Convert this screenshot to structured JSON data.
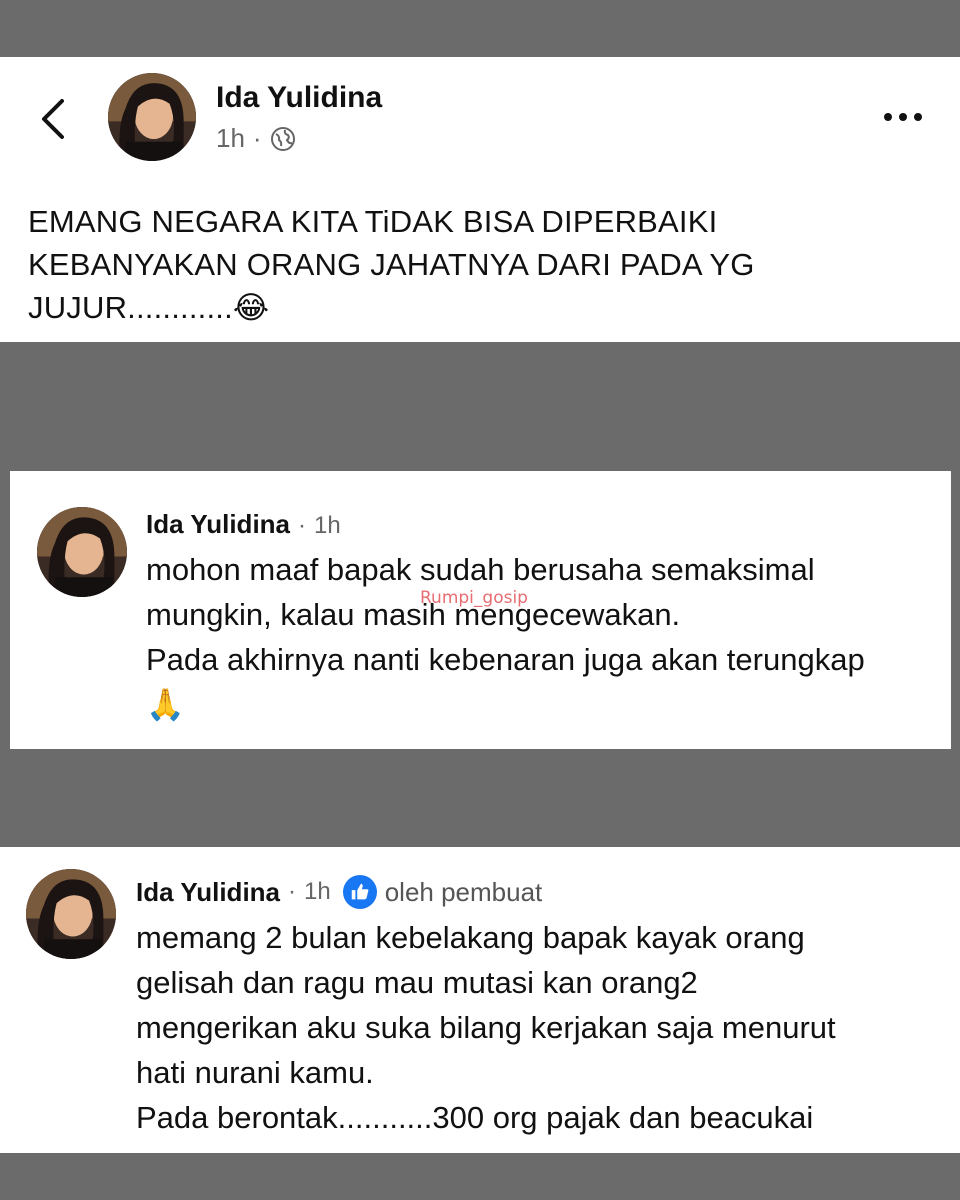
{
  "post": {
    "author": "Ida Yulidina",
    "time": "1h",
    "separator": "·",
    "privacy_icon": "globe-icon",
    "text": "EMANG NEGARA KITA TiDAK BISA DIPERBAIKI\nKEBANYAKAN ORANG JAHATNYA DARI PADA YG\nJUJUR............😂"
  },
  "comment1": {
    "author": "Ida Yulidina",
    "separator": "·",
    "time": "1h",
    "text": "mohon maaf bapak sudah berusaha semaksimal\nmungkin, kalau masih mengecewakan.\nPada akhirnya nanti kebenaran juga akan terungkap\n🙏",
    "watermark": "Rumpi_gosip"
  },
  "comment2": {
    "author": "Ida Yulidina",
    "separator": "·",
    "time": "1h",
    "badge_icon": "thumbs-up-icon",
    "author_tag": "oleh pembuat",
    "text": "memang 2 bulan kebelakang bapak kayak orang\ngelisah dan ragu mau mutasi kan orang2\nmengerikan aku suka bilang kerjakan saja menurut\nhati nurani kamu.\nPada berontak...........300 org pajak dan beacukai"
  },
  "colors": {
    "background": "#6b6b6b",
    "panel": "#ffffff",
    "like_blue": "#1877f2",
    "watermark": "#e3545a"
  }
}
